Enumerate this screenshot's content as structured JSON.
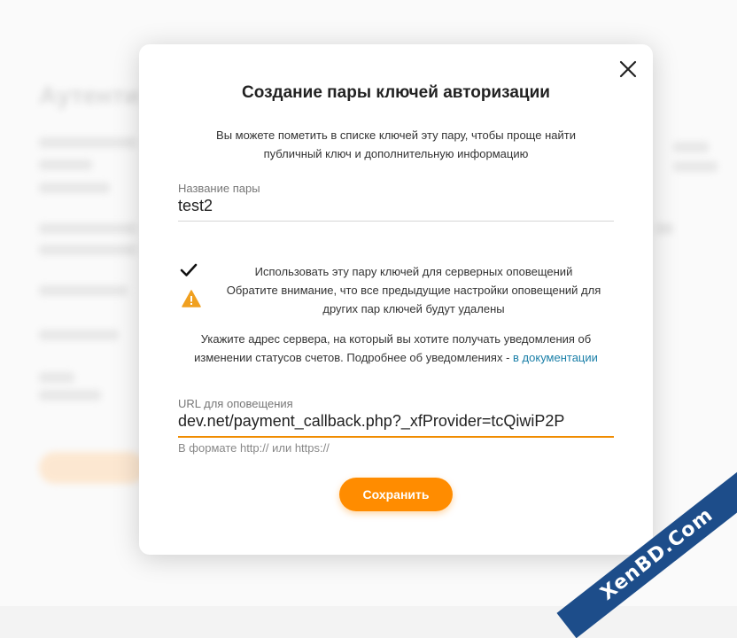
{
  "modal": {
    "title": "Создание пары ключей авторизации",
    "description": "Вы можете пометить в списке ключей эту пару, чтобы проще найти публичный ключ и дополнительную информацию",
    "pair_name": {
      "label": "Название пары",
      "value": "test2"
    },
    "server_notify": {
      "checked": true,
      "label": "Использовать эту пару ключей для серверных оповещений",
      "warning": "Обратите внимание, что все предыдущие настройки оповещений для других пар ключей будут удалены"
    },
    "server_info": {
      "text": "Укажите адрес сервера, на который вы хотите получать уведомления об изменении статусов счетов. Подробнее об уведомлениях - ",
      "link": "в документации"
    },
    "url_field": {
      "label": "URL для оповещения",
      "value": "dev.net/payment_callback.php?_xfProvider=tcQiwiP2P",
      "hint": "В формате http:// или https://"
    },
    "save_label": "Сохранить"
  },
  "watermark": "XenBD.Com",
  "colors": {
    "accent": "#ff8c00",
    "link": "#1a7fa8",
    "warning": "#f0a020",
    "watermark_bg": "#1d4d8a"
  }
}
